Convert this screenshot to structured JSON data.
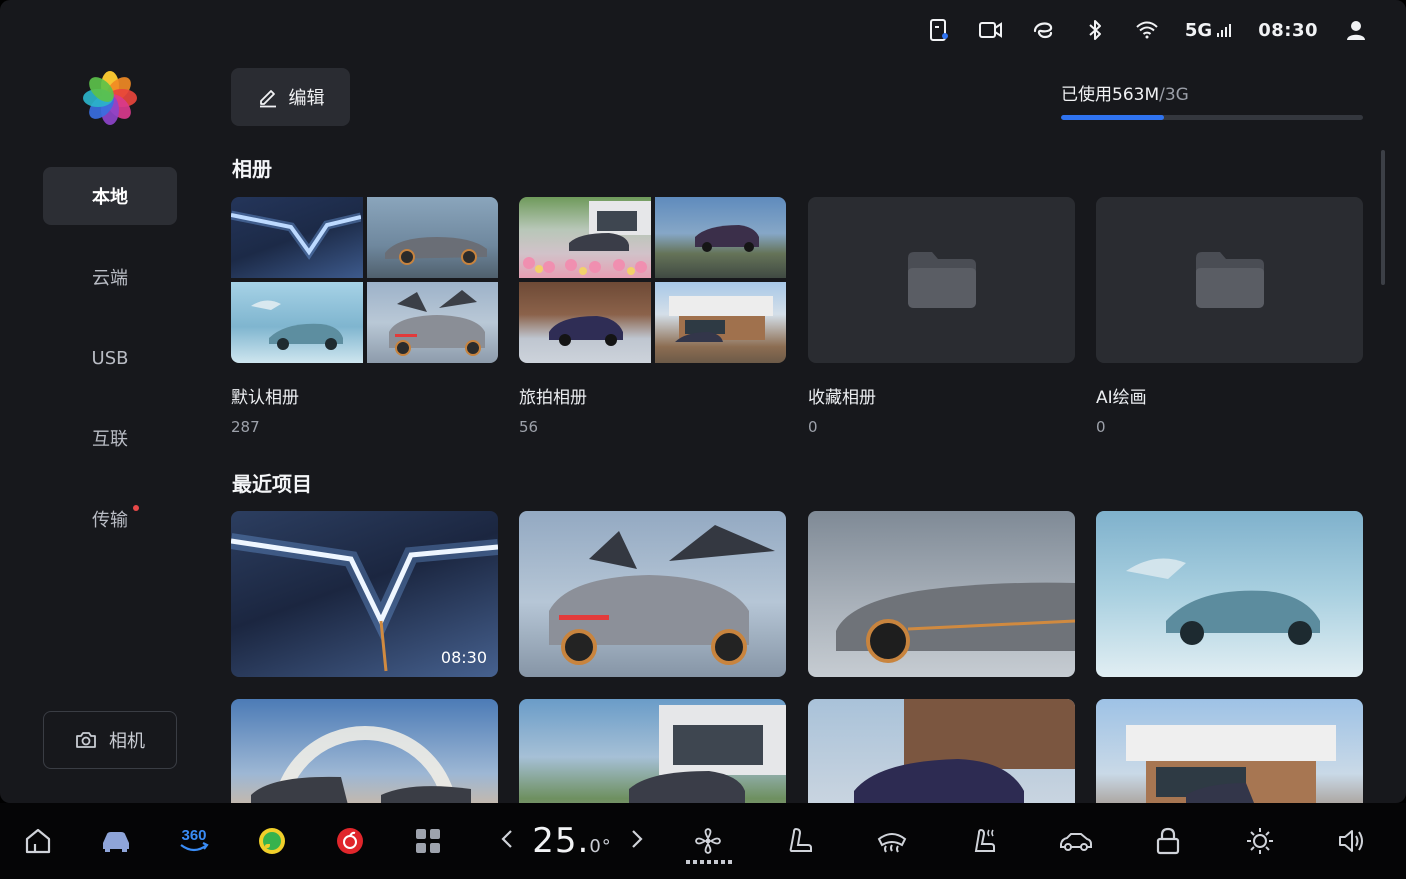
{
  "status_bar": {
    "icons": [
      "phone-key-icon",
      "video-camera-icon",
      "hicar-link-icon",
      "bluetooth-icon",
      "wifi-icon"
    ],
    "network": "5G",
    "time": "08:30",
    "user_icon": "user-icon"
  },
  "sidebar": {
    "items": [
      {
        "label": "本地",
        "active": true
      },
      {
        "label": "云端",
        "active": false
      },
      {
        "label": "USB",
        "active": false
      },
      {
        "label": "互联",
        "active": false
      },
      {
        "label": "传输",
        "active": false,
        "notification_dot": true
      }
    ],
    "camera_label": "相机"
  },
  "toolbar": {
    "edit_label": "编辑"
  },
  "storage": {
    "used": "已使用563M",
    "total": "/3G",
    "fraction": 0.34
  },
  "albums_section": {
    "title": "相册",
    "albums": [
      {
        "name": "默认相册",
        "count": "287"
      },
      {
        "name": "旅拍相册",
        "count": "56"
      },
      {
        "name": "收藏相册",
        "count": "0"
      },
      {
        "name": "AI绘画",
        "count": "0"
      }
    ]
  },
  "recent_section": {
    "title": "最近项目",
    "video_duration": "08:30"
  },
  "dock": {
    "temperature": "25.",
    "temperature_decimal": "0°",
    "badge_360": "360",
    "fan_level": 0.8,
    "icons": [
      "home-icon",
      "car-icon",
      "360-view-icon",
      "music-icon",
      "netease-music-icon",
      "apps-grid-icon",
      "chevron-left-icon",
      "chevron-right-icon",
      "fan-icon",
      "seat-icon",
      "defrost-icon",
      "seat-heat-icon",
      "car-mode-icon",
      "lock-icon",
      "brightness-icon",
      "volume-icon"
    ]
  },
  "colors": {
    "accent": "#2f73f0",
    "background": "#17181c",
    "card": "#2a2c31",
    "dock": "#050506",
    "notification": "#e74848"
  }
}
